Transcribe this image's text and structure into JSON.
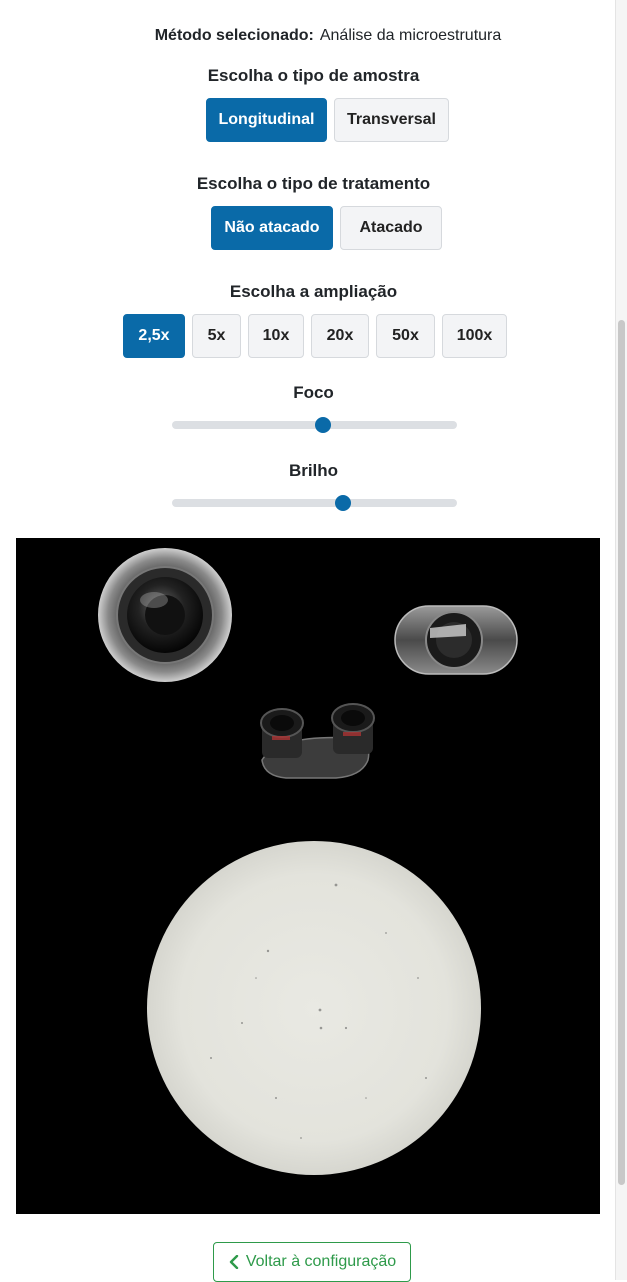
{
  "method": {
    "label": "Método selecionado:",
    "value": "Análise da microestrutura"
  },
  "sample": {
    "heading": "Escolha o tipo de amostra",
    "options": [
      "Longitudinal",
      "Transversal"
    ],
    "selected": "Longitudinal"
  },
  "treatment": {
    "heading": "Escolha o tipo de tratamento",
    "options": [
      "Não atacado",
      "Atacado"
    ],
    "selected": "Não atacado"
  },
  "magnification": {
    "heading": "Escolha a ampliação",
    "options": [
      "2,5x",
      "5x",
      "10x",
      "20x",
      "50x",
      "100x"
    ],
    "selected": "2,5x"
  },
  "focus": {
    "label": "Foco",
    "value_fraction": 0.53
  },
  "brightness": {
    "label": "Brilho",
    "value_fraction": 0.6
  },
  "back_button": {
    "label": "Voltar à configuração",
    "icon": "chevron-left-icon"
  },
  "colors": {
    "primary": "#0a6aa8",
    "success": "#2e9a4a",
    "viewer_bg": "#000000"
  }
}
